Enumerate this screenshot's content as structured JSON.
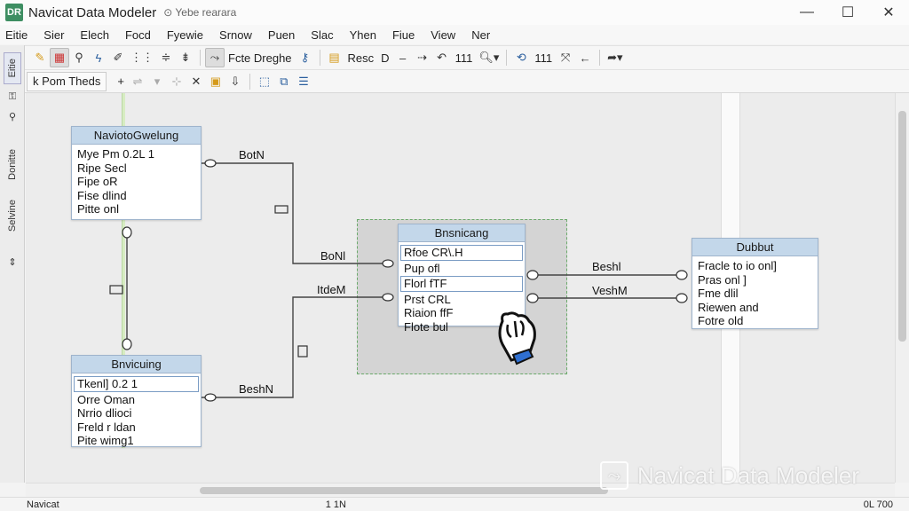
{
  "window": {
    "app_icon": "DR",
    "title": "Navicat Data Modeler",
    "title_extra": "⊙ Yebe rearara",
    "minimize": "—",
    "maximize": "☐",
    "close": "✕"
  },
  "menu": [
    "Eitie",
    "Sier",
    "Elech",
    "Focd",
    "Fyewie",
    "Srnow",
    "Puen",
    "Slac",
    "Yhen",
    "Fiue",
    "View",
    "Ner"
  ],
  "toolbar1": {
    "icons": [
      "folder-icon",
      "table-icon",
      "pin-icon",
      "lightning-icon",
      "pen-icon",
      "grid-icon",
      "align-icon"
    ],
    "btn_a": "Fcte Dreghe",
    "btn_b": "Resc",
    "btn_b2": "D",
    "btn_c": "111",
    "btn_d": "111"
  },
  "toolbar2": {
    "tab_label": "k Pom Theds",
    "add": "+"
  },
  "left_strip": {
    "item1": "Eitie",
    "item2": "Donitte",
    "item3": "Selvine"
  },
  "entities": {
    "e1": {
      "title": "NaviotoGwelung",
      "fields": [
        "Mye  Pm  0.2L  1",
        "Ripe  Secl",
        "Fipe  oR",
        "Fise  dlind",
        "Pitte  onl"
      ]
    },
    "e2": {
      "title": "Bnvicuing",
      "fields": [
        "Tkenl]  0.2  1",
        "Orre  Oman",
        "Nrrio  dlioci",
        "Freld  r ldan",
        "Pite  wimg1"
      ]
    },
    "e3": {
      "title": "Bnsnicang",
      "fields": [
        "Rfoe  CR\\.H",
        "Pup  ofl",
        "Florl  fTF",
        "Prst  CRL",
        "Riaion  ffF",
        "Flote  bul"
      ]
    },
    "e4": {
      "title": "Dubbut",
      "fields": [
        "Fracle  to  io  onl]",
        "Pras  onl  ]",
        "Fme  dlil",
        "Riewen  and",
        "Fotre  old"
      ]
    }
  },
  "relations": {
    "r1": "BotN",
    "r2": "BoNl",
    "r3": "ItdeM",
    "r4": "BeshN",
    "r5": "Beshl",
    "r6": "VeshM"
  },
  "status": {
    "left": "Navicat",
    "mid": "1 1N",
    "zoom": "0L 700"
  },
  "watermark": "Navicat Data Modeler"
}
